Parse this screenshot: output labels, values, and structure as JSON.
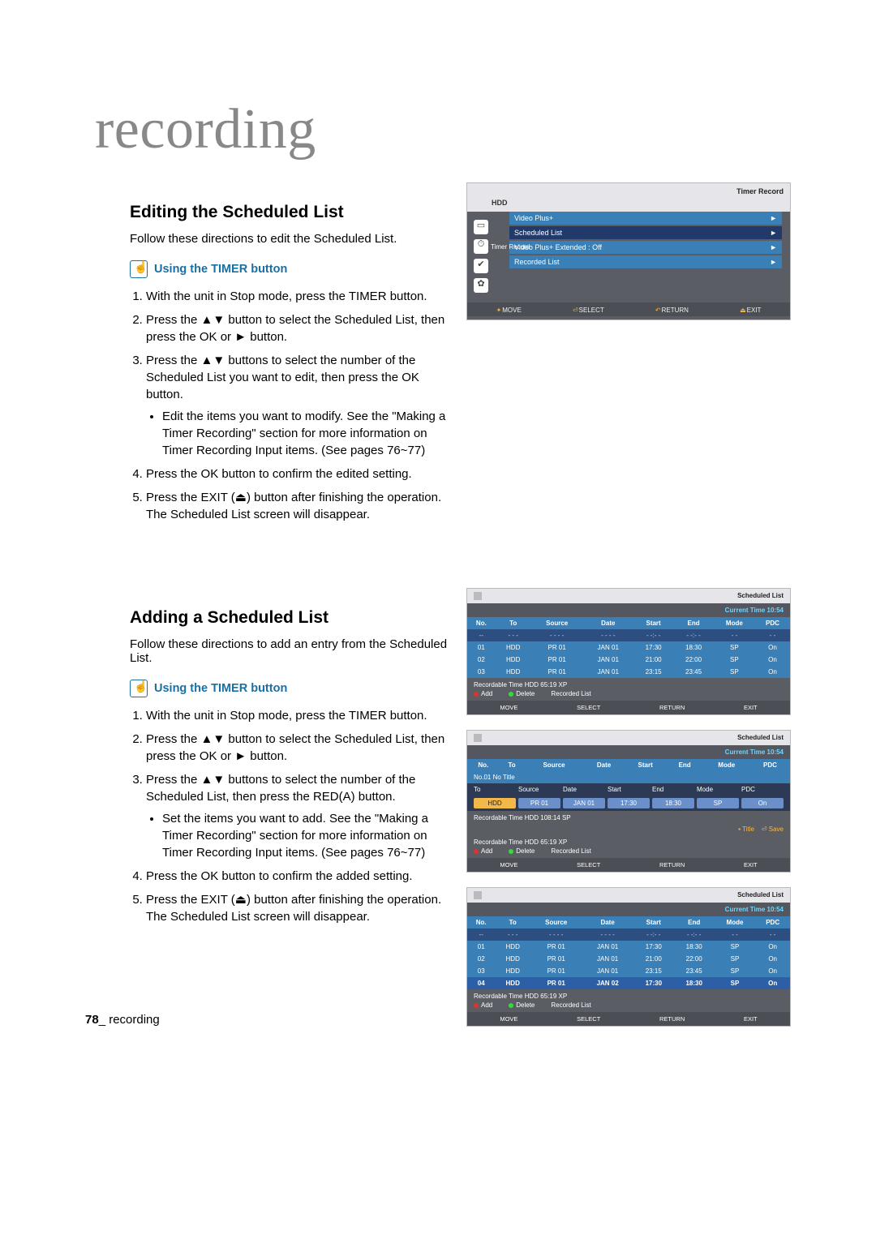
{
  "page": {
    "title": "recording",
    "footer_page": "78",
    "footer_text": "_ recording"
  },
  "editing": {
    "heading": "Editing the Scheduled List",
    "intro": "Follow these directions to edit the Scheduled List.",
    "sub": "Using the TIMER button",
    "step1": "With the unit in Stop mode, press the TIMER button.",
    "step2": "Press the ▲▼ button to select the Scheduled List, then press the OK or ► button.",
    "step3": "Press the ▲▼ buttons to select the number of the Scheduled List you want to edit, then press the OK button.",
    "step3_bullet": "Edit the items you want to modify. See the \"Making a Timer Recording\" section for more information on Timer Recording Input items. (See pages 76~77)",
    "step4": "Press the OK button to confirm the edited setting.",
    "step5a": "Press the EXIT (",
    "step5b": ") button after finishing the operation. The Scheduled List screen will disappear."
  },
  "adding": {
    "heading": "Adding a Scheduled List",
    "intro": "Follow these directions to add an entry from the Scheduled List.",
    "sub": "Using the TIMER button",
    "step1": "With the unit in Stop mode, press the TIMER button.",
    "step2": "Press the ▲▼ button to select the Scheduled List, then press the OK or ► button.",
    "step3": "Press the ▲▼ buttons to select the number of the Scheduled List, then press the RED(A) button.",
    "step3_bullet": "Set the items you want to add. See the \"Making a Timer Recording\" section for more information on Timer Recording Input items. (See pages 76~77)",
    "step4": "Press the OK button to confirm the added setting.",
    "step5a": "Press the EXIT (",
    "step5b": ") button after finishing the operation. The Scheduled List screen will disappear."
  },
  "osd_timer": {
    "title": "Timer Record",
    "topbar": "HDD",
    "left_tag": "Timer Record",
    "menu": {
      "m1": "Video Plus+",
      "m2": "Scheduled List",
      "m3": "Video Plus+ Extended : Off",
      "m4": "Recorded List"
    },
    "help": {
      "move": "MOVE",
      "select": "SELECT",
      "ret": "RETURN",
      "exit": "EXIT"
    }
  },
  "osd_list_common": {
    "title": "Scheduled List",
    "time_label": "Current Time 10:54",
    "columns": {
      "no": "No.",
      "to": "To",
      "source": "Source",
      "date": "Date",
      "start": "Start",
      "end": "End",
      "mode": "Mode",
      "pdc": "PDC"
    },
    "rec_info": "Recordable Time HDD 65:19 XP",
    "rec_info2": "Recordable Time HDD 108:14 SP",
    "btn_add": "Add",
    "btn_delete": "Delete",
    "btn_reclist": "Recorded List",
    "help": {
      "move": "MOVE",
      "select": "SELECT",
      "ret": "RETURN",
      "exit": "EXIT"
    },
    "title_action": "Title",
    "save_action": "Save"
  },
  "osd_list1": {
    "input_row": {
      "no": "--",
      "to": "- - -",
      "source": "- - - -",
      "date": "- - - -",
      "start": "- -:- -",
      "end": "- -:- -",
      "mode": "- -",
      "pdc": "- -"
    },
    "rows": [
      {
        "no": "01",
        "to": "HDD",
        "source": "PR 01",
        "date": "JAN 01",
        "start": "17:30",
        "end": "18:30",
        "mode": "SP",
        "pdc": "On"
      },
      {
        "no": "02",
        "to": "HDD",
        "source": "PR 01",
        "date": "JAN 01",
        "start": "21:00",
        "end": "22:00",
        "mode": "SP",
        "pdc": "On"
      },
      {
        "no": "03",
        "to": "HDD",
        "source": "PR 01",
        "date": "JAN 01",
        "start": "23:15",
        "end": "23:45",
        "mode": "SP",
        "pdc": "On"
      }
    ]
  },
  "osd_list2": {
    "sub_title": "No.01 No Title",
    "edit_hdr": {
      "to": "To",
      "source": "Source",
      "date": "Date",
      "start": "Start",
      "end": "End",
      "mode": "Mode",
      "pdc": "PDC"
    },
    "edit_vals": {
      "to": "HDD",
      "source": "PR 01",
      "date": "JAN 01",
      "start": "17:30",
      "end": "18:30",
      "mode": "SP",
      "pdc": "On"
    },
    "actions": {
      "title": "Title",
      "save": "Save"
    }
  },
  "osd_list3": {
    "input_row": {
      "no": "--",
      "to": "- - -",
      "source": "- - - -",
      "date": "- - - -",
      "start": "- -:- -",
      "end": "- -:- -",
      "mode": "- -",
      "pdc": "- -"
    },
    "rows": [
      {
        "no": "01",
        "to": "HDD",
        "source": "PR 01",
        "date": "JAN 01",
        "start": "17:30",
        "end": "18:30",
        "mode": "SP",
        "pdc": "On"
      },
      {
        "no": "02",
        "to": "HDD",
        "source": "PR 01",
        "date": "JAN 01",
        "start": "21:00",
        "end": "22:00",
        "mode": "SP",
        "pdc": "On"
      },
      {
        "no": "03",
        "to": "HDD",
        "source": "PR 01",
        "date": "JAN 01",
        "start": "23:15",
        "end": "23:45",
        "mode": "SP",
        "pdc": "On"
      },
      {
        "no": "04",
        "to": "HDD",
        "source": "PR 01",
        "date": "JAN 02",
        "start": "17:30",
        "end": "18:30",
        "mode": "SP",
        "pdc": "On"
      }
    ]
  }
}
